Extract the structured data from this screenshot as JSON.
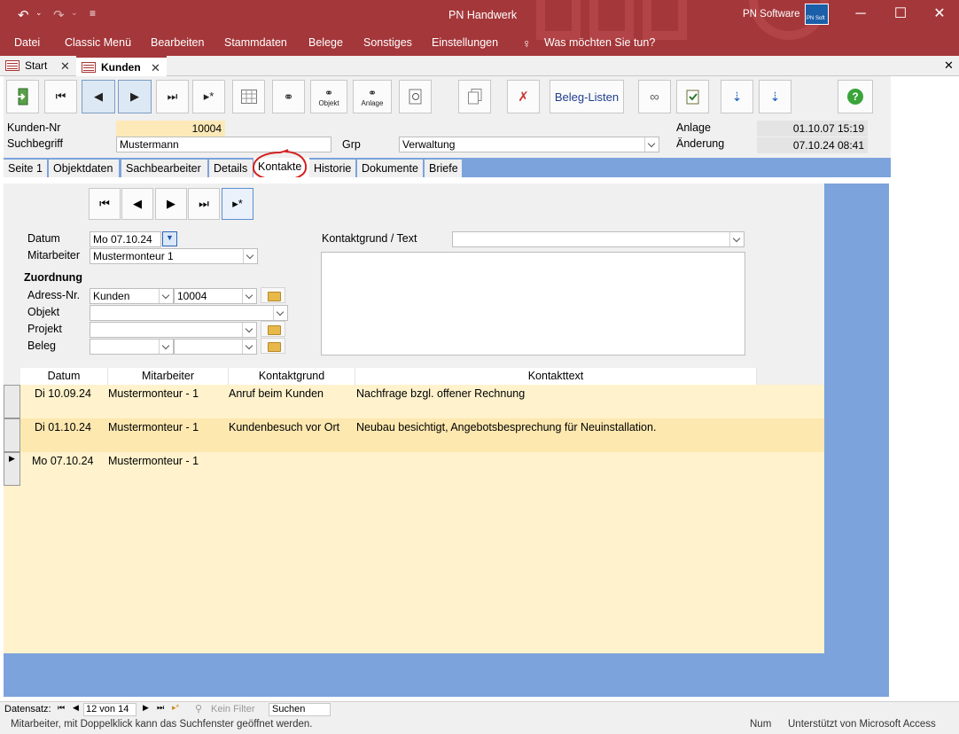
{
  "window": {
    "title": "PN Handwerk",
    "brand": "PN Software",
    "brand_logo": "PN Soft",
    "accent": "#a4373a"
  },
  "menu": {
    "items": [
      "Datei",
      "Classic Menü",
      "Bearbeiten",
      "Stammdaten",
      "Belege",
      "Sonstiges",
      "Einstellungen"
    ],
    "tell_me": "Was möchten Sie tun?"
  },
  "doc_tabs": [
    {
      "label": "Start"
    },
    {
      "label": "Kunden"
    }
  ],
  "toolbar": {
    "objekt_label": "Objekt",
    "anlage_label": "Anlage",
    "beleg_listen_label": "Beleg-Listen"
  },
  "header": {
    "kunden_nr_label": "Kunden-Nr",
    "kunden_nr_value": "10004",
    "suchbegriff_label": "Suchbegriff",
    "suchbegriff_value": "Mustermann",
    "grp_label": "Grp",
    "grp_value": "Verwaltung",
    "anlage_label": "Anlage",
    "anlage_value": "01.10.07 15:19",
    "aenderung_label": "Änderung",
    "aenderung_value": "07.10.24 08:41"
  },
  "form_tabs": [
    {
      "label": "Seite 1"
    },
    {
      "label": "Objektdaten"
    },
    {
      "label": "Sachbearbeiter"
    },
    {
      "label": "Details"
    },
    {
      "label": "Kontakte"
    },
    {
      "label": "Historie"
    },
    {
      "label": "Dokumente"
    },
    {
      "label": "Briefe"
    }
  ],
  "kontakt_form": {
    "datum_label": "Datum",
    "datum_value": "Mo 07.10.24",
    "mitarbeiter_label": "Mitarbeiter",
    "mitarbeiter_value": "Mustermonteur 1",
    "zuordnung_label": "Zuordnung",
    "adress_nr_label": "Adress-Nr.",
    "adress_type_value": "Kunden",
    "adress_nr_value": "10004",
    "objekt_label": "Objekt",
    "projekt_label": "Projekt",
    "beleg_label": "Beleg",
    "kontaktgrund_label": "Kontaktgrund / Text"
  },
  "grid": {
    "headers": [
      "Datum",
      "Mitarbeiter",
      "Kontaktgrund",
      "Kontakttext"
    ],
    "rows": [
      [
        "Di 10.09.24",
        "Mustermonteur - 1",
        "Anruf beim Kunden",
        "Nachfrage bzgl. offener Rechnung"
      ],
      [
        "Di 01.10.24",
        "Mustermonteur - 1",
        "Kundenbesuch vor Ort",
        "Neubau besichtigt, Angebotsbesprechung für Neuinstallation."
      ],
      [
        "Mo 07.10.24",
        "Mustermonteur - 1",
        "",
        ""
      ]
    ]
  },
  "record_nav": {
    "label": "Datensatz:",
    "position": "12 von 14",
    "filter": "Kein Filter",
    "search": "Suchen"
  },
  "status": {
    "text": "Mitarbeiter, mit Doppelklick kann das Suchfenster geöffnet werden.",
    "num": "Num",
    "access": "Unterstützt von Microsoft Access"
  },
  "colors": {
    "panel_bg": "#fff2cc",
    "row_highlight": "#fde8b0",
    "field_highlight": "#fde9b7",
    "circle": "#d52020"
  }
}
